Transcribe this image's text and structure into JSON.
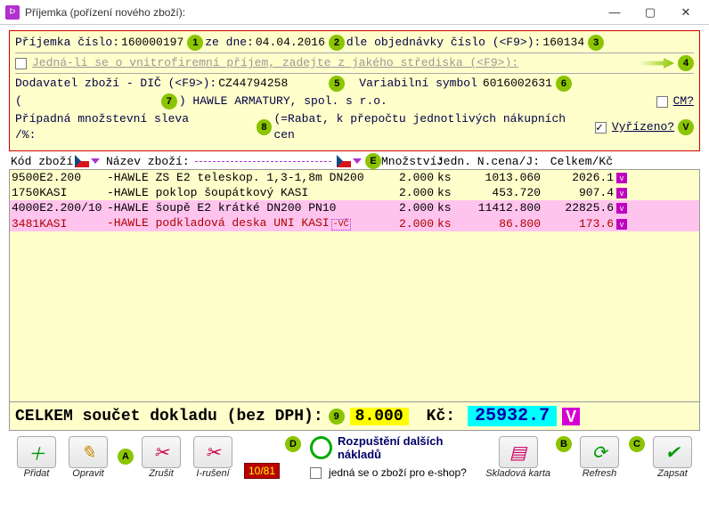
{
  "window": {
    "title": "Příjemka (pořízení nového zboží):"
  },
  "header": {
    "prijemka_lbl": "Příjemka číslo:",
    "prijemka_no": "160000197",
    "ze_dne_lbl": "ze dne:",
    "ze_dne": "04.04.2016",
    "dle_obj_lbl": "dle objednávky číslo (<F9>):",
    "obj_no": "160134",
    "internal_lbl": "Jedná-li se o vnitrofiremní příjem, zadejte z jakého střediska (<F9>):",
    "dodavatel_lbl": "Dodavatel zboží - DIČ (<F9>):",
    "dic": "CZ44794258",
    "vs_lbl": "Variabilní symbol",
    "vs": "6016002631",
    "firma_pre": "(",
    "firma_post": ") HAWLE ARMATURY, spol. s r.o.",
    "cm_lbl": "CM?",
    "sleva_lbl": "Případná množstevní sleva /%:",
    "sleva_note": "(=Rabat, k přepočtu jednotlivých nákupních cen",
    "vyrizeno_lbl": "Vyřízeno?"
  },
  "columns": {
    "code": "Kód zboží",
    "name": "Název zboží:",
    "qty": "Množství:",
    "unit": "Jedn.",
    "price": "N.cena/J:",
    "total": "Celkem/Kč"
  },
  "rows": [
    {
      "code": "9500E2.200",
      "name": "-HAWLE ZS E2 teleskop. 1,3-1,8m DN200",
      "qty": "2.000",
      "unit": "ks",
      "price": "1013.060",
      "total": "2026.1",
      "pink": false
    },
    {
      "code": "1750KASI",
      "name": "-HAWLE poklop šoupátkový KASI",
      "qty": "2.000",
      "unit": "ks",
      "price": "453.720",
      "total": "907.4",
      "pink": false
    },
    {
      "code": "4000E2.200/10",
      "name": "-HAWLE šoupě E2 krátké DN200 PN10",
      "qty": "2.000",
      "unit": "ks",
      "price": "11412.800",
      "total": "22825.6",
      "pink": true
    },
    {
      "code": "3481KASI",
      "name": "-HAWLE podkladová deska UNI KASI",
      "qty": "2.000",
      "unit": "ks",
      "price": "86.800",
      "total": "173.6",
      "pink": true,
      "sel": true,
      "vc": "-VČ"
    }
  ],
  "totals": {
    "label": "CELKEM součet dokladu (bez DPH):",
    "qty": "8.000",
    "kc_lbl": "Kč:",
    "kc": "25932.7"
  },
  "toolbar": {
    "pridat": "Přidat",
    "opravit": "Opravit",
    "zrusit": "Zrušit",
    "iruseni": "I-rušení",
    "counter": "10/81",
    "rozp": "Rozpuštění dalších nákladů",
    "eshop": "jedná se o zboží pro e-shop?",
    "sklad": "Skladová karta",
    "refresh": "Refresh",
    "zapsat": "Zapsat"
  },
  "tags": {
    "t1": "1",
    "t2": "2",
    "t3": "3",
    "t4": "4",
    "t5": "5",
    "t6": "6",
    "t7": "7",
    "t8": "8",
    "t9": "9",
    "tA": "A",
    "tB": "B",
    "tC": "C",
    "tD": "D",
    "tE": "E",
    "tV": "V"
  }
}
